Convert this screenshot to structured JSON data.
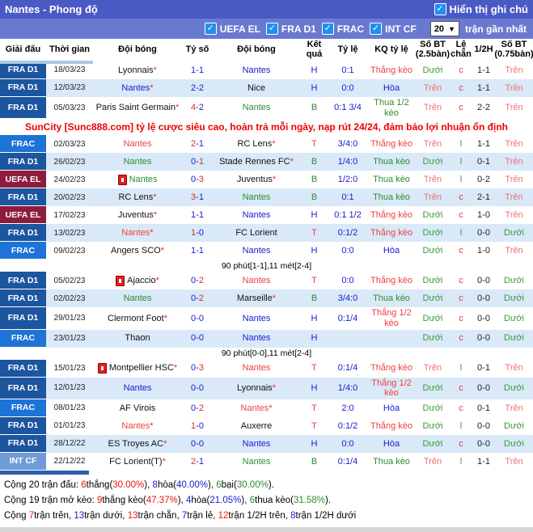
{
  "header": {
    "title": "Nantes - Phong độ",
    "note_toggle_label": "Hiển thị ghi chú",
    "note_toggle_checked": true
  },
  "filters": {
    "leagues": [
      {
        "label": "UEFA EL",
        "checked": true
      },
      {
        "label": "FRA D1",
        "checked": true
      },
      {
        "label": "FRAC",
        "checked": true
      },
      {
        "label": "INT CF",
        "checked": true
      }
    ],
    "recent_select_value": "20",
    "recent_label": "trận gần nhất"
  },
  "columns": [
    "Giải đấu",
    "Thời gian",
    "Đội bóng",
    "Tỷ số",
    "Đội bóng",
    "Kết quả",
    "Tỷ lệ",
    "KQ tỷ lệ",
    "Số BT (2.5bàn)",
    "Lệ chẵn",
    "1/2H",
    "Số BT (0.75bàn)"
  ],
  "ad_text": "SunCity [Sunc888.com] tỷ lệ cược siêu cao, hoàn trả mỗi ngày, nạp rút 24/24, đảm bảo lợi nhuận ổn định",
  "league_colors": {
    "FRA D1": "#1c55a0",
    "FRAC": "#1e73d6",
    "UEFA EL": "#8e1c3d",
    "INT CF": "#6f9cd6"
  },
  "result_colors": {
    "win": "#ef4040",
    "draw": "#1a1acf",
    "loss": "#2e8b2e",
    "over": "#f26f6f",
    "under": "#3a9a3a"
  },
  "rows": [
    {
      "type": "match",
      "stripe": false,
      "league": "FRA D1",
      "lc": "frad1",
      "date": "18/03/23",
      "home": "Lyonnais",
      "home_star": true,
      "home_c": "opp",
      "home_card": false,
      "sh": "1",
      "sa": "1",
      "winside": "none",
      "away": "Nantes",
      "away_star": false,
      "away_c": "draw",
      "res": "H",
      "res_c": "draw",
      "odds": "0:1",
      "kq": "Thắng kèo",
      "kq_c": "win",
      "bt25": "Dưới",
      "bt25_c": "under",
      "le": "c",
      "le_c": "even",
      "h12": "1-1",
      "bt075": "Trên",
      "bt075_c": "over"
    },
    {
      "type": "match",
      "stripe": true,
      "league": "FRA D1",
      "lc": "frad1",
      "date": "12/03/23",
      "home": "Nantes",
      "home_star": true,
      "home_c": "draw",
      "home_card": false,
      "sh": "2",
      "sa": "2",
      "winside": "none",
      "away": "Nice",
      "away_star": false,
      "away_c": "opp",
      "res": "H",
      "res_c": "draw",
      "odds": "0:0",
      "kq": "Hòa",
      "kq_c": "draw",
      "bt25": "Trên",
      "bt25_c": "over",
      "le": "c",
      "le_c": "even",
      "h12": "1-1",
      "bt075": "Trên",
      "bt075_c": "over"
    },
    {
      "type": "match",
      "stripe": false,
      "league": "FRA D1",
      "lc": "frad1",
      "date": "05/03/23",
      "home": "Paris Saint Germain",
      "home_star": true,
      "home_c": "opp",
      "home_card": false,
      "sh": "4",
      "sa": "2",
      "winside": "h",
      "away": "Nantes",
      "away_star": false,
      "away_c": "loss",
      "res": "B",
      "res_c": "loss",
      "odds": "0:1 3/4",
      "kq": "Thua 1/2 kèo",
      "kq_c": "loss",
      "bt25": "Trên",
      "bt25_c": "over",
      "le": "c",
      "le_c": "even",
      "h12": "2-2",
      "bt075": "Trên",
      "bt075_c": "over"
    },
    {
      "type": "ad"
    },
    {
      "type": "match",
      "stripe": false,
      "league": "FRAC",
      "lc": "frac",
      "date": "02/03/23",
      "home": "Nantes",
      "home_star": false,
      "home_c": "win",
      "home_card": false,
      "sh": "2",
      "sa": "1",
      "winside": "h",
      "away": "RC Lens",
      "away_star": true,
      "away_c": "opp",
      "res": "T",
      "res_c": "win",
      "odds": "3/4:0",
      "kq": "Thắng kèo",
      "kq_c": "win",
      "bt25": "Trên",
      "bt25_c": "over",
      "le": "l",
      "le_c": "odd",
      "h12": "1-1",
      "bt075": "Trên",
      "bt075_c": "over"
    },
    {
      "type": "match",
      "stripe": true,
      "league": "FRA D1",
      "lc": "frad1",
      "date": "26/02/23",
      "home": "Nantes",
      "home_star": false,
      "home_c": "loss",
      "home_card": false,
      "sh": "0",
      "sa": "1",
      "winside": "a",
      "away": "Stade Rennes FC",
      "away_star": true,
      "away_c": "opp",
      "res": "B",
      "res_c": "loss",
      "odds": "1/4:0",
      "kq": "Thua kèo",
      "kq_c": "loss",
      "bt25": "Dưới",
      "bt25_c": "under",
      "le": "l",
      "le_c": "odd",
      "h12": "0-1",
      "bt075": "Trên",
      "bt075_c": "over"
    },
    {
      "type": "match",
      "stripe": false,
      "league": "UEFA EL",
      "lc": "uefa",
      "date": "24/02/23",
      "home": "Nantes",
      "home_star": false,
      "home_c": "loss",
      "home_card": true,
      "sh": "0",
      "sa": "3",
      "winside": "a",
      "away": "Juventus",
      "away_star": true,
      "away_c": "opp",
      "res": "B",
      "res_c": "loss",
      "odds": "1/2:0",
      "kq": "Thua kèo",
      "kq_c": "loss",
      "bt25": "Trên",
      "bt25_c": "over",
      "le": "l",
      "le_c": "odd",
      "h12": "0-2",
      "bt075": "Trên",
      "bt075_c": "over"
    },
    {
      "type": "match",
      "stripe": true,
      "league": "FRA D1",
      "lc": "frad1",
      "date": "20/02/23",
      "home": "RC Lens",
      "home_star": true,
      "home_c": "opp",
      "home_card": false,
      "sh": "3",
      "sa": "1",
      "winside": "h",
      "away": "Nantes",
      "away_star": false,
      "away_c": "loss",
      "res": "B",
      "res_c": "loss",
      "odds": "0:1",
      "kq": "Thua kèo",
      "kq_c": "loss",
      "bt25": "Trên",
      "bt25_c": "over",
      "le": "c",
      "le_c": "even",
      "h12": "2-1",
      "bt075": "Trên",
      "bt075_c": "over"
    },
    {
      "type": "match",
      "stripe": false,
      "league": "UEFA EL",
      "lc": "uefa",
      "date": "17/02/23",
      "home": "Juventus",
      "home_star": true,
      "home_c": "opp",
      "home_card": false,
      "sh": "1",
      "sa": "1",
      "winside": "none",
      "away": "Nantes",
      "away_star": false,
      "away_c": "draw",
      "res": "H",
      "res_c": "draw",
      "odds": "0:1 1/2",
      "kq": "Thắng kèo",
      "kq_c": "win",
      "bt25": "Dưới",
      "bt25_c": "under",
      "le": "c",
      "le_c": "even",
      "h12": "1-0",
      "bt075": "Trên",
      "bt075_c": "over"
    },
    {
      "type": "match",
      "stripe": true,
      "league": "FRA D1",
      "lc": "frad1",
      "date": "13/02/23",
      "home": "Nantes",
      "home_star": true,
      "home_c": "win",
      "home_card": false,
      "sh": "1",
      "sa": "0",
      "winside": "h",
      "away": "FC Lorient",
      "away_star": false,
      "away_c": "opp",
      "res": "T",
      "res_c": "win",
      "odds": "0:1/2",
      "kq": "Thắng kèo",
      "kq_c": "win",
      "bt25": "Dưới",
      "bt25_c": "under",
      "le": "l",
      "le_c": "odd",
      "h12": "0-0",
      "bt075": "Dưới",
      "bt075_c": "under"
    },
    {
      "type": "match",
      "stripe": false,
      "league": "FRAC",
      "lc": "frac",
      "date": "09/02/23",
      "home": "Angers SCO",
      "home_star": true,
      "home_c": "opp",
      "home_card": false,
      "sh": "1",
      "sa": "1",
      "winside": "none",
      "away": "Nantes",
      "away_star": false,
      "away_c": "draw",
      "res": "H",
      "res_c": "draw",
      "odds": "0:0",
      "kq": "Hòa",
      "kq_c": "draw",
      "bt25": "Dưới",
      "bt25_c": "under",
      "le": "c",
      "le_c": "even",
      "h12": "1-0",
      "bt075": "Trên",
      "bt075_c": "over"
    },
    {
      "type": "note",
      "text": "90 phút[1-1],11 mét[2-4]"
    },
    {
      "type": "match",
      "stripe": false,
      "league": "FRA D1",
      "lc": "frad1",
      "date": "05/02/23",
      "home": "Ajaccio",
      "home_star": true,
      "home_c": "opp",
      "home_card": true,
      "sh": "0",
      "sa": "2",
      "winside": "a",
      "away": "Nantes",
      "away_star": false,
      "away_c": "win",
      "res": "T",
      "res_c": "win",
      "odds": "0:0",
      "kq": "Thắng kèo",
      "kq_c": "win",
      "bt25": "Dưới",
      "bt25_c": "under",
      "le": "c",
      "le_c": "even",
      "h12": "0-0",
      "bt075": "Dưới",
      "bt075_c": "under"
    },
    {
      "type": "match",
      "stripe": true,
      "league": "FRA D1",
      "lc": "frad1",
      "date": "02/02/23",
      "home": "Nantes",
      "home_star": false,
      "home_c": "loss",
      "home_card": false,
      "sh": "0",
      "sa": "2",
      "winside": "a",
      "away": "Marseille",
      "away_star": true,
      "away_c": "opp",
      "res": "B",
      "res_c": "loss",
      "odds": "3/4:0",
      "kq": "Thua kèo",
      "kq_c": "loss",
      "bt25": "Dưới",
      "bt25_c": "under",
      "le": "c",
      "le_c": "even",
      "h12": "0-0",
      "bt075": "Dưới",
      "bt075_c": "under"
    },
    {
      "type": "match",
      "stripe": false,
      "league": "FRA D1",
      "lc": "frad1",
      "date": "29/01/23",
      "home": "Clermont Foot",
      "home_star": true,
      "home_c": "opp",
      "home_card": false,
      "sh": "0",
      "sa": "0",
      "winside": "none",
      "away": "Nantes",
      "away_star": false,
      "away_c": "draw",
      "res": "H",
      "res_c": "draw",
      "odds": "0:1/4",
      "kq": "Thắng 1/2 kèo",
      "kq_c": "win",
      "bt25": "Dưới",
      "bt25_c": "under",
      "le": "c",
      "le_c": "even",
      "h12": "0-0",
      "bt075": "Dưới",
      "bt075_c": "under"
    },
    {
      "type": "match",
      "stripe": true,
      "league": "FRAC",
      "lc": "frac",
      "date": "23/01/23",
      "home": "Thaon",
      "home_star": false,
      "home_c": "opp",
      "home_card": false,
      "sh": "0",
      "sa": "0",
      "winside": "none",
      "away": "Nantes",
      "away_star": false,
      "away_c": "draw",
      "res": "H",
      "res_c": "draw",
      "odds": "",
      "kq": "",
      "kq_c": "draw",
      "bt25": "Dưới",
      "bt25_c": "under",
      "le": "c",
      "le_c": "even",
      "h12": "0-0",
      "bt075": "Dưới",
      "bt075_c": "under"
    },
    {
      "type": "note",
      "text": "90 phút[0-0],11 mét[2-4]"
    },
    {
      "type": "match",
      "stripe": false,
      "league": "FRA D1",
      "lc": "frad1",
      "date": "15/01/23",
      "home": "Montpellier HSC",
      "home_star": true,
      "home_c": "opp",
      "home_card": true,
      "sh": "0",
      "sa": "3",
      "winside": "a",
      "away": "Nantes",
      "away_star": false,
      "away_c": "win",
      "res": "T",
      "res_c": "win",
      "odds": "0:1/4",
      "kq": "Thắng kèo",
      "kq_c": "win",
      "bt25": "Trên",
      "bt25_c": "over",
      "le": "l",
      "le_c": "odd",
      "h12": "0-1",
      "bt075": "Trên",
      "bt075_c": "over"
    },
    {
      "type": "match",
      "stripe": true,
      "league": "FRA D1",
      "lc": "frad1",
      "date": "12/01/23",
      "home": "Nantes",
      "home_star": false,
      "home_c": "draw",
      "home_card": false,
      "sh": "0",
      "sa": "0",
      "winside": "none",
      "away": "Lyonnais",
      "away_star": true,
      "away_c": "opp",
      "res": "H",
      "res_c": "draw",
      "odds": "1/4:0",
      "kq": "Thắng 1/2 kèo",
      "kq_c": "win",
      "bt25": "Dưới",
      "bt25_c": "under",
      "le": "c",
      "le_c": "even",
      "h12": "0-0",
      "bt075": "Dưới",
      "bt075_c": "under"
    },
    {
      "type": "match",
      "stripe": false,
      "league": "FRAC",
      "lc": "frac",
      "date": "08/01/23",
      "home": "AF Virois",
      "home_star": false,
      "home_c": "opp",
      "home_card": false,
      "sh": "0",
      "sa": "2",
      "winside": "a",
      "away": "Nantes",
      "away_star": true,
      "away_c": "win",
      "res": "T",
      "res_c": "win",
      "odds": "2:0",
      "kq": "Hòa",
      "kq_c": "draw",
      "bt25": "Dưới",
      "bt25_c": "under",
      "le": "c",
      "le_c": "even",
      "h12": "0-1",
      "bt075": "Trên",
      "bt075_c": "over"
    },
    {
      "type": "match",
      "stripe": false,
      "league": "FRA D1",
      "lc": "frad1",
      "date": "01/01/23",
      "home": "Nantes",
      "home_star": true,
      "home_c": "win",
      "home_card": false,
      "sh": "1",
      "sa": "0",
      "winside": "h",
      "away": "Auxerre",
      "away_star": false,
      "away_c": "opp",
      "res": "T",
      "res_c": "win",
      "odds": "0:1/2",
      "kq": "Thắng kèo",
      "kq_c": "win",
      "bt25": "Dưới",
      "bt25_c": "under",
      "le": "l",
      "le_c": "odd",
      "h12": "0-0",
      "bt075": "Dưới",
      "bt075_c": "under"
    },
    {
      "type": "match",
      "stripe": true,
      "league": "FRA D1",
      "lc": "frad1",
      "date": "28/12/22",
      "home": "ES Troyes AC",
      "home_star": true,
      "home_c": "opp",
      "home_card": false,
      "sh": "0",
      "sa": "0",
      "winside": "none",
      "away": "Nantes",
      "away_star": false,
      "away_c": "draw",
      "res": "H",
      "res_c": "draw",
      "odds": "0:0",
      "kq": "Hòa",
      "kq_c": "draw",
      "bt25": "Dưới",
      "bt25_c": "under",
      "le": "c",
      "le_c": "even",
      "h12": "0-0",
      "bt075": "Dưới",
      "bt075_c": "under"
    },
    {
      "type": "match",
      "stripe": false,
      "league": "INT CF",
      "lc": "intcf",
      "date": "22/12/22",
      "home": "FC Lorient(T)",
      "home_star": true,
      "home_c": "opp",
      "home_card": false,
      "sh": "2",
      "sa": "1",
      "winside": "h",
      "away": "Nantes",
      "away_star": false,
      "away_c": "loss",
      "res": "B",
      "res_c": "loss",
      "odds": "0:1/4",
      "kq": "Thua kèo",
      "kq_c": "loss",
      "bt25": "Trên",
      "bt25_c": "over",
      "le": "l",
      "le_c": "odd",
      "h12": "1-1",
      "bt075": "Trên",
      "bt075_c": "over"
    }
  ],
  "summary": [
    [
      {
        "t": "Cộng ",
        "c": "k"
      },
      {
        "t": "20 trận đấu: ",
        "c": "k"
      },
      {
        "t": "6",
        "c": "r"
      },
      {
        "t": "thắng(",
        "c": "k"
      },
      {
        "t": "30.00%",
        "c": "r"
      },
      {
        "t": "), ",
        "c": "k"
      },
      {
        "t": "8",
        "c": "b"
      },
      {
        "t": "hòa(",
        "c": "k"
      },
      {
        "t": "40.00%",
        "c": "b"
      },
      {
        "t": "), ",
        "c": "k"
      },
      {
        "t": "6",
        "c": "g"
      },
      {
        "t": "bại(",
        "c": "k"
      },
      {
        "t": "30.00%",
        "c": "g"
      },
      {
        "t": ").",
        "c": "k"
      }
    ],
    [
      {
        "t": "Cộng ",
        "c": "k"
      },
      {
        "t": "19 trận mở kèo: ",
        "c": "k"
      },
      {
        "t": "9",
        "c": "r"
      },
      {
        "t": "thắng kèo(",
        "c": "k"
      },
      {
        "t": "47.37%",
        "c": "r"
      },
      {
        "t": "), ",
        "c": "k"
      },
      {
        "t": "4",
        "c": "b"
      },
      {
        "t": "hòa(",
        "c": "k"
      },
      {
        "t": "21.05%",
        "c": "b"
      },
      {
        "t": "), ",
        "c": "k"
      },
      {
        "t": "6",
        "c": "g"
      },
      {
        "t": "thua kèo(",
        "c": "k"
      },
      {
        "t": "31.58%",
        "c": "g"
      },
      {
        "t": ").",
        "c": "k"
      }
    ],
    [
      {
        "t": "Cộng ",
        "c": "k"
      },
      {
        "t": "7",
        "c": "r"
      },
      {
        "t": "trận trên, ",
        "c": "k"
      },
      {
        "t": "13",
        "c": "b"
      },
      {
        "t": "trận dưới, ",
        "c": "k"
      },
      {
        "t": "13",
        "c": "r"
      },
      {
        "t": "trận chẵn, ",
        "c": "k"
      },
      {
        "t": "7",
        "c": "b"
      },
      {
        "t": "trận lẻ, ",
        "c": "k"
      },
      {
        "t": "12",
        "c": "r"
      },
      {
        "t": "trận 1/2H trên, ",
        "c": "k"
      },
      {
        "t": "8",
        "c": "b"
      },
      {
        "t": "trận 1/2H dưới",
        "c": "k"
      }
    ]
  ]
}
